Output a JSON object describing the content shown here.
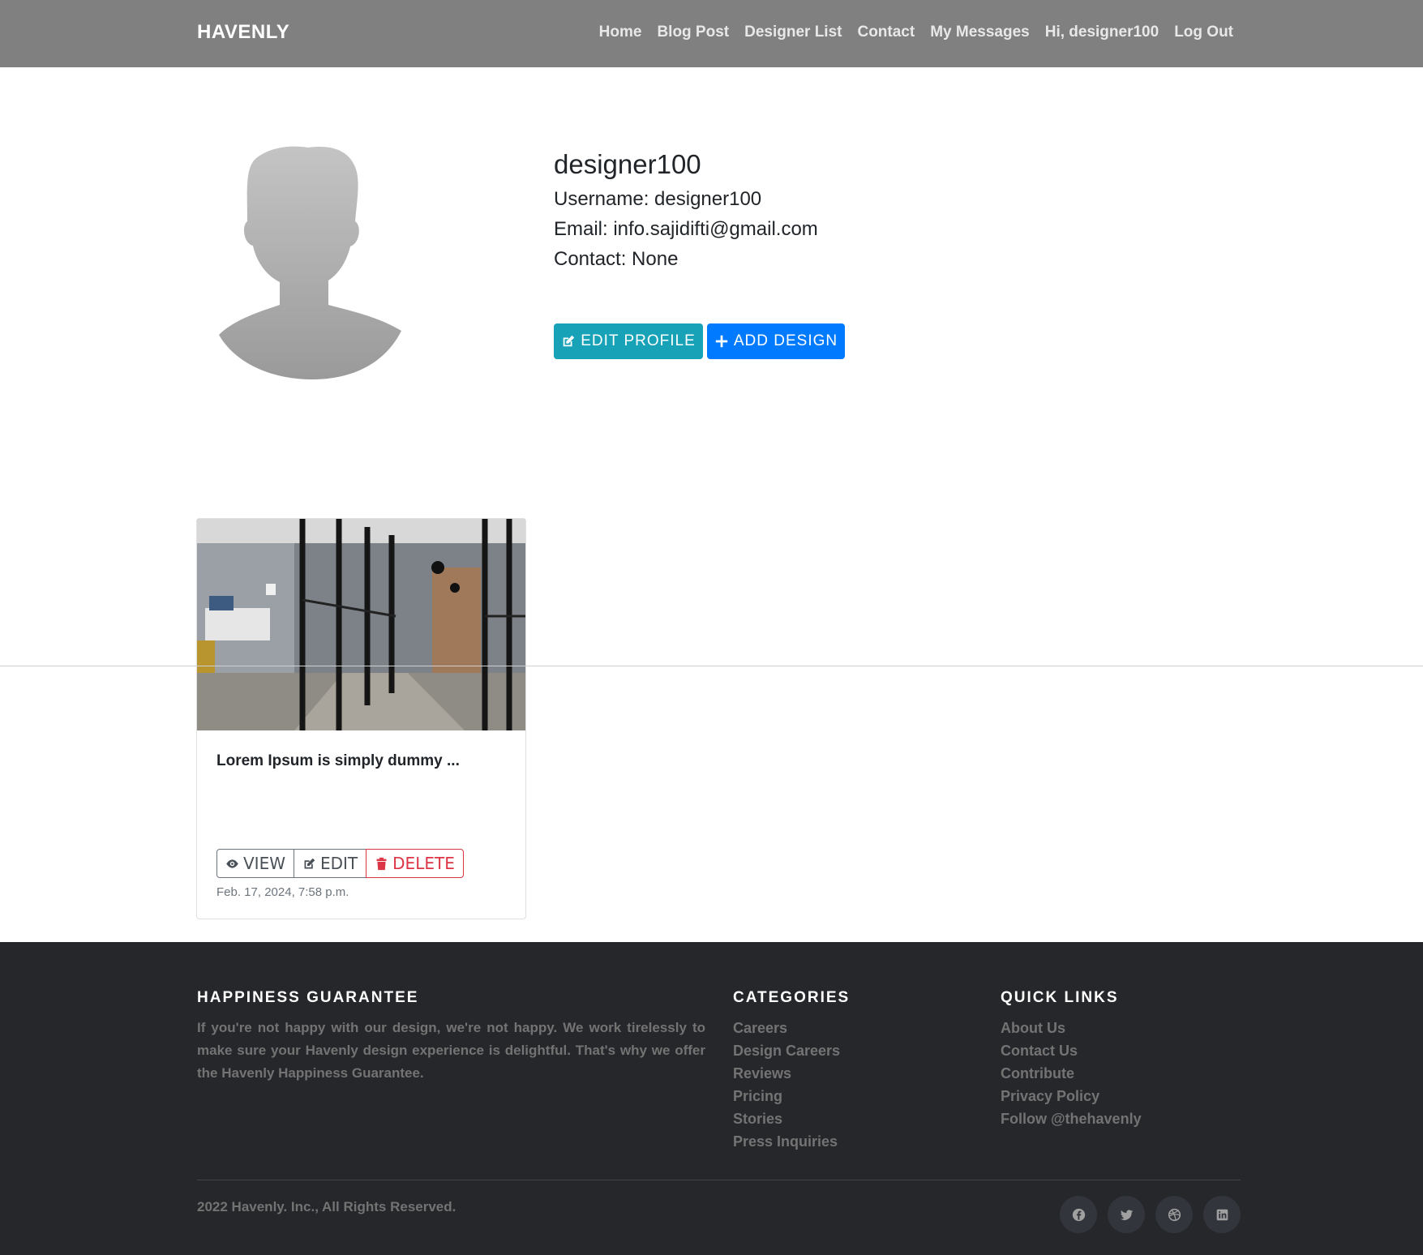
{
  "nav": {
    "brand": "HAVENLY",
    "links": [
      "Home",
      "Blog Post",
      "Designer List",
      "Contact",
      "My Messages",
      "Hi, designer100",
      "Log Out"
    ]
  },
  "profile": {
    "name": "designer100",
    "username": "Username: designer100",
    "email": "Email: info.sajidifti@gmail.com",
    "contact": "Contact: None",
    "edit_label": "EDIT PROFILE",
    "add_label": "ADD DESIGN"
  },
  "design_card": {
    "title": "Lorem Ipsum is simply dummy ...",
    "view_label": "VIEW",
    "edit_label": "EDIT",
    "delete_label": "DELETE",
    "date": "Feb. 17, 2024, 7:58 p.m."
  },
  "footer": {
    "guarantee_heading": "HAPPINESS GUARANTEE",
    "guarantee_text": "If you're not happy with our design, we're not happy. We work tirelessly to make sure your Havenly design experience is delightful. That's why we offer the Havenly Happiness Guarantee.",
    "categories_heading": "CATEGORIES",
    "categories": [
      "Careers",
      "Design Careers",
      "Reviews",
      "Pricing",
      "Stories",
      "Press Inquiries"
    ],
    "quicklinks_heading": "QUICK LINKS",
    "quicklinks": [
      "About Us",
      "Contact Us",
      "Contribute",
      "Privacy Policy",
      "Follow @thehavenly"
    ],
    "copyright": "2022 Havenly. Inc., All Rights Reserved.",
    "socials": [
      "facebook-icon",
      "twitter-icon",
      "dribbble-icon",
      "linkedin-icon"
    ]
  },
  "colors": {
    "navbar": "#808080",
    "edit_button": "#17a2b8",
    "add_button": "#007bff",
    "delete": "#dc3545",
    "footer": "#26272b"
  }
}
